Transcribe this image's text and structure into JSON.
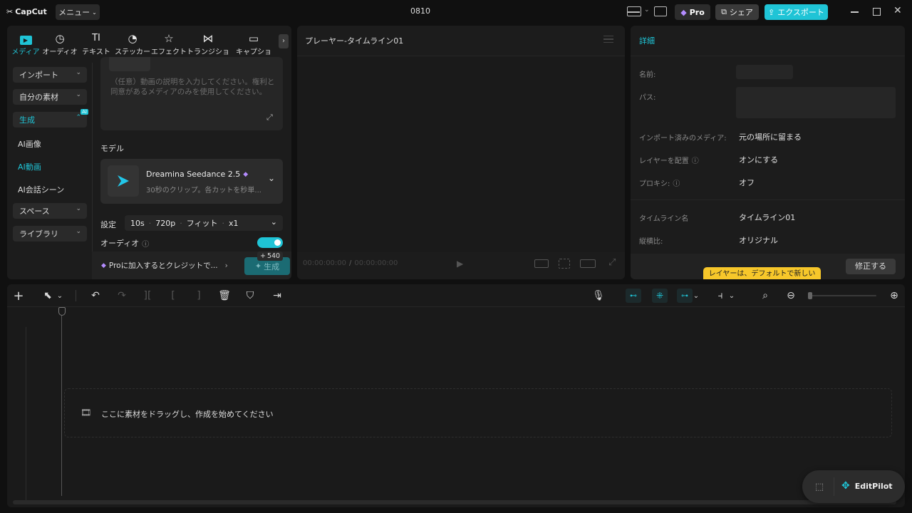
{
  "app": {
    "logo": "CapCut",
    "menu_label": "メニュー",
    "project_title": "0810",
    "pro_label": "Pro",
    "share_label": "シェア",
    "export_label": "エクスポート",
    "accent_color": "#1fc4d6"
  },
  "tabs": [
    {
      "label": "メディア",
      "icon": "media-icon",
      "glyph": "▶",
      "active": true
    },
    {
      "label": "オーディオ",
      "icon": "audio-icon",
      "glyph": "♪"
    },
    {
      "label": "テキスト",
      "icon": "text-icon",
      "glyph": "TI"
    },
    {
      "label": "ステッカー",
      "icon": "sticker-icon",
      "glyph": "◔"
    },
    {
      "label": "エフェクト",
      "icon": "effect-icon",
      "glyph": "☆"
    },
    {
      "label": "トランジション",
      "icon": "transition-icon",
      "glyph": "⋈"
    },
    {
      "label": "キャプション",
      "icon": "caption-icon",
      "glyph": "▭"
    }
  ],
  "sidebar": {
    "import": "インポート",
    "my_assets": "自分の素材",
    "generate": "生成",
    "ai_badge": "AI",
    "ai_image": "AI画像",
    "ai_video": "AI動画",
    "ai_dialogue": "AI会話シーン",
    "space": "スペース",
    "library": "ライブラリ"
  },
  "generate_panel": {
    "prompt_placeholder": "（任意）動画の説明を入力してください。権利と同意があるメディアのみを使用してください。",
    "model_heading": "モデル",
    "model_name": "Dreamina Seedance 2.5",
    "model_desc": "30秒のクリップ。各カットを秒単...",
    "settings_label": "設定",
    "setting_duration": "10s",
    "setting_resolution": "720p",
    "setting_fit": "フィット",
    "setting_count": "x1",
    "audio_label": "オーディオ",
    "audio_on": true,
    "pro_promo": "Proに加入するとクレジットで...",
    "credits": "540",
    "generate_button": "生成"
  },
  "player": {
    "title": "プレーヤー-タイムライン01",
    "timecode_current": "00:00:00:00",
    "timecode_total": "00:00:00:00"
  },
  "details": {
    "title": "詳細",
    "name_label": "名前:",
    "path_label": "パス:",
    "imported_media_label": "インポート済みのメディア:",
    "imported_media_value": "元の場所に留まる",
    "layer_label": "レイヤーを配置",
    "layer_value": "オンにする",
    "proxy_label": "プロキシ:",
    "proxy_value": "オフ",
    "timeline_name_label": "タイムライン名",
    "timeline_name_value": "タイムライン01",
    "aspect_label": "縦横比:",
    "aspect_value": "オリジナル",
    "tooltip": "レイヤーは、デフォルトで新しい",
    "edit_button": "修正する"
  },
  "timeline": {
    "drop_hint": "ここに素材をドラッグし、作成を始めてください",
    "editpilot_label": "EditPilot"
  }
}
